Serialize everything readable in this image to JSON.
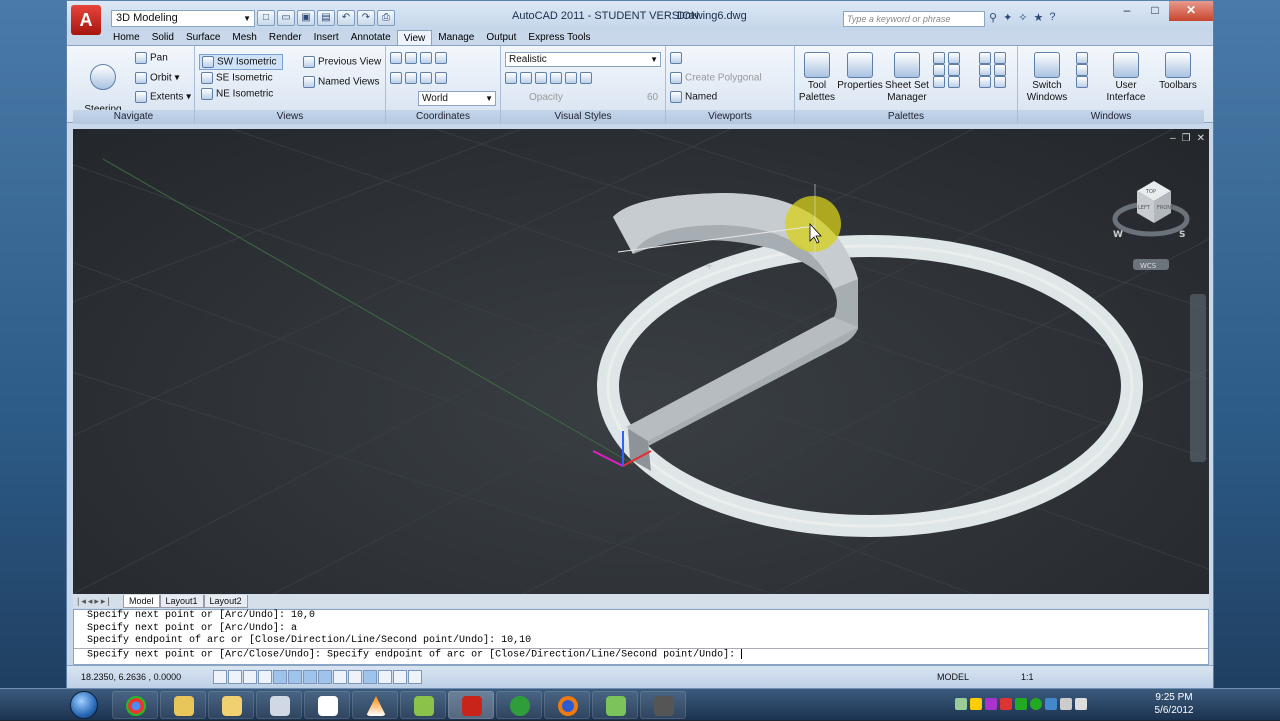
{
  "window": {
    "title": "AutoCAD 2011 - STUDENT VERSION",
    "document": "Drawing6.dwg",
    "workspace": "3D Modeling",
    "search_placeholder": "Type a keyword or phrase"
  },
  "tabs": [
    "Home",
    "Solid",
    "Surface",
    "Mesh",
    "Render",
    "Insert",
    "Annotate",
    "View",
    "Manage",
    "Output",
    "Express Tools"
  ],
  "active_tab": "View",
  "ribbon": {
    "navigate": {
      "title": "Navigate",
      "steering_wheels": "Steering\nWheels",
      "pan": "Pan",
      "orbit": "Orbit",
      "extents": "Extents"
    },
    "views": {
      "title": "Views",
      "items": [
        "SW Isometric",
        "SE Isometric",
        "NE Isometric"
      ],
      "previous_view": "Previous View",
      "named_views": "Named Views"
    },
    "coordinates": {
      "title": "Coordinates",
      "ucs": "World"
    },
    "visual_styles": {
      "title": "Visual Styles",
      "style": "Realistic",
      "opacity_label": "Opacity",
      "opacity_value": "60"
    },
    "viewports": {
      "title": "Viewports",
      "create_polygonal": "Create Polygonal",
      "named": "Named"
    },
    "palettes": {
      "title": "Palettes",
      "tool_palettes": "Tool\nPalettes",
      "properties": "Properties",
      "sheet_set": "Sheet Set\nManager"
    },
    "windows": {
      "title": "Windows",
      "switch_windows": "Switch\nWindows",
      "user_interface": "User\nInterface",
      "toolbars": "Toolbars"
    }
  },
  "viewcube": {
    "top": "TOP",
    "left": "LEFT",
    "front": "FRONT",
    "w": "W",
    "s": "S",
    "wcs": "WCS"
  },
  "layout_tabs": [
    "Model",
    "Layout1",
    "Layout2"
  ],
  "command_history": [
    "Specify next point or [Arc/Undo]: 10,0",
    "Specify next point or [Arc/Undo]: a",
    "Specify endpoint of arc or [Close/Direction/Line/Second point/Undo]: 10,10"
  ],
  "command_input": "Specify next point or [Arc/Close/Undo]: Specify endpoint of arc or [Close/Direction/Line/Second point/Undo]: ",
  "status": {
    "coords": "18.2350, 6.2636 , 0.0000",
    "model": "MODEL",
    "scale": "1:1"
  },
  "clock": {
    "time": "9:25 PM",
    "date": "5/6/2012"
  },
  "colors": {
    "accent": "#c8d8ea",
    "viewport_bg": "#2d3237",
    "title_red": "#c8452e"
  }
}
